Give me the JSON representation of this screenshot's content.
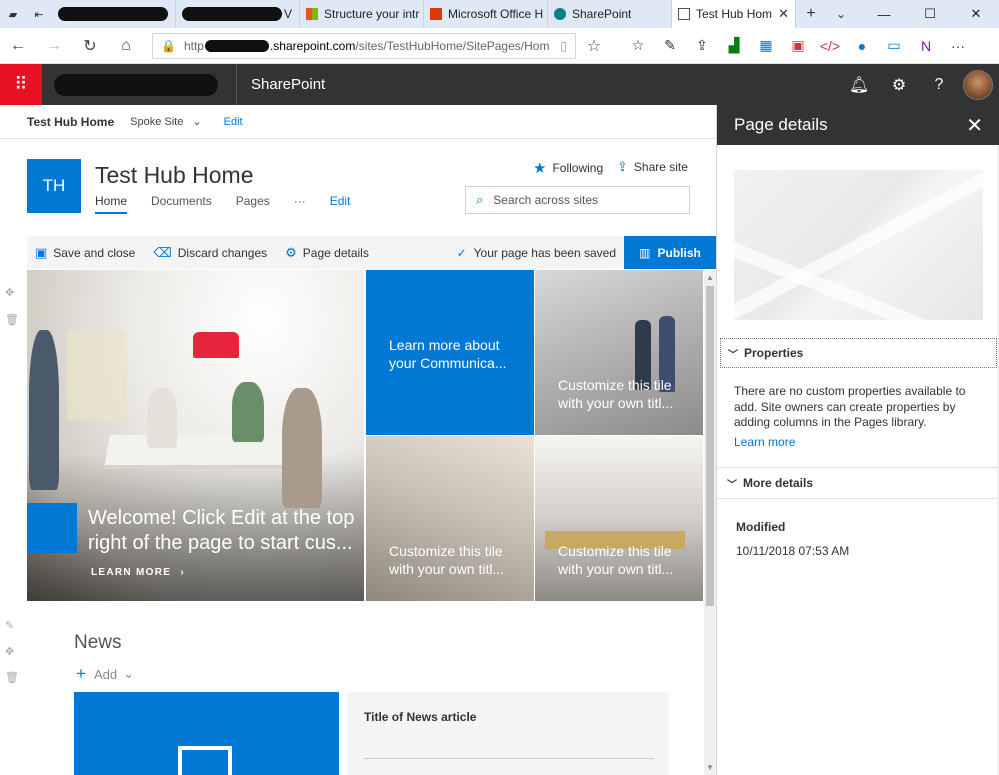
{
  "browser": {
    "tabs": [
      {
        "label": "",
        "redacted": true
      },
      {
        "label": "",
        "redacted": true
      },
      {
        "label": "Structure your intr"
      },
      {
        "label": "Microsoft Office H"
      },
      {
        "label": "SharePoint"
      },
      {
        "label": "Test Hub Hom",
        "active": true
      }
    ],
    "redacted_tab_suffix": "V",
    "url_prefix": "http",
    "url_host": ".sharepoint.com",
    "url_path": "/sites/TestHubHome/SitePages/Hom"
  },
  "suite": {
    "app_name": "SharePoint"
  },
  "hub_nav": {
    "home": "Test Hub Home",
    "spoke": "Spoke Site",
    "edit": "Edit"
  },
  "site": {
    "logo_initials": "TH",
    "title": "Test Hub Home",
    "nav": [
      "Home",
      "Documents",
      "Pages",
      "···",
      "Edit"
    ],
    "following": "Following",
    "share": "Share site",
    "search_placeholder": "Search across sites"
  },
  "command_bar": {
    "save_close": "Save and close",
    "discard": "Discard changes",
    "page_details": "Page details",
    "saved_status": "Your page has been saved",
    "publish": "Publish"
  },
  "hero": {
    "main_text": "Welcome! Click Edit at the top right of the page to start cus...",
    "learn_more": "LEARN MORE",
    "tile_blue": "Learn more about your Communica...",
    "tile_generic": "Customize this tile with your own titl..."
  },
  "news": {
    "title": "News",
    "add": "Add",
    "article_title": "Title of News article"
  },
  "panel": {
    "title": "Page details",
    "properties_heading": "Properties",
    "properties_text": "There are no custom properties available to add. Site owners can create properties by adding columns in the Pages library.",
    "learn_more": "Learn more",
    "more_details_heading": "More details",
    "modified_label": "Modified",
    "modified_value": "10/11/2018 07:53 AM"
  },
  "colors": {
    "accent": "#0078d4",
    "suite_bar": "#333333",
    "waffle": "#e81123"
  }
}
